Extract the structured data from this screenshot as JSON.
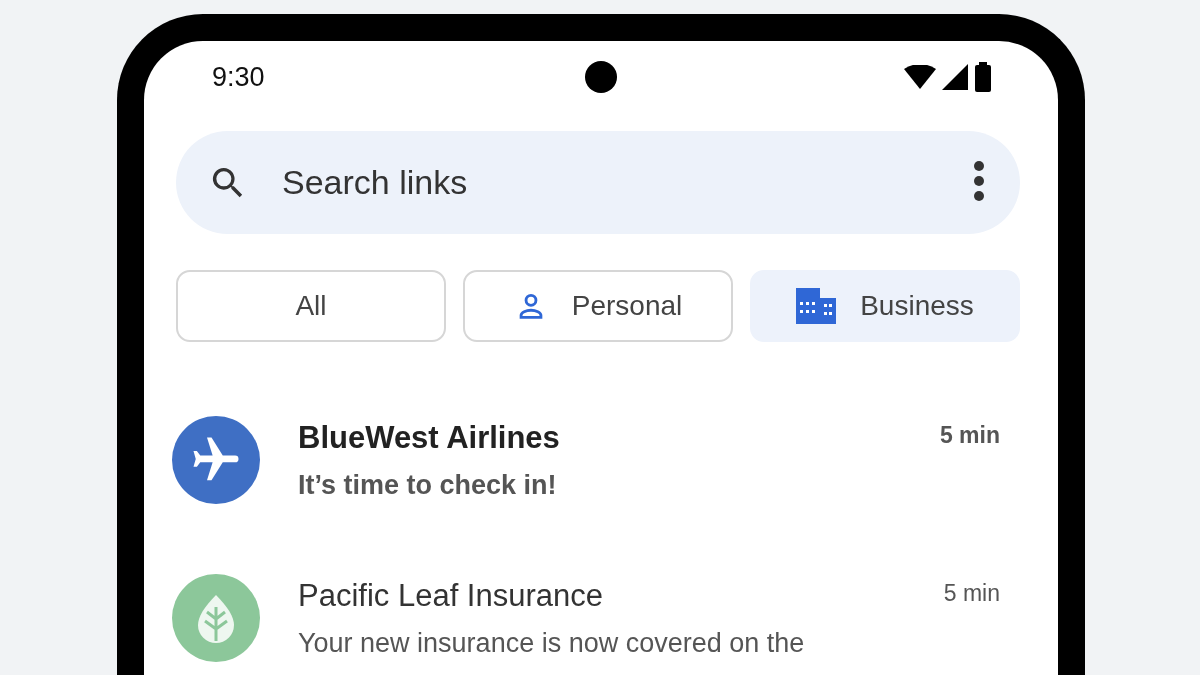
{
  "status_bar": {
    "time": "9:30"
  },
  "search": {
    "placeholder": "Search links"
  },
  "filters": [
    {
      "label": "All",
      "kind": "plain",
      "selected": false
    },
    {
      "label": "Personal",
      "kind": "personal",
      "selected": false
    },
    {
      "label": "Business",
      "kind": "business",
      "selected": true
    }
  ],
  "conversations": [
    {
      "name": "BlueWest Airlines",
      "message": "It’s time to check in!",
      "time": "5 min",
      "unread": true,
      "kind": "airline",
      "color": "#3f6fc4"
    },
    {
      "name": "Pacific Leaf Insurance",
      "message": "Your new insurance is now covered on the",
      "time": "5 min",
      "unread": false,
      "kind": "insurance",
      "color": "#8cc79a"
    }
  ]
}
